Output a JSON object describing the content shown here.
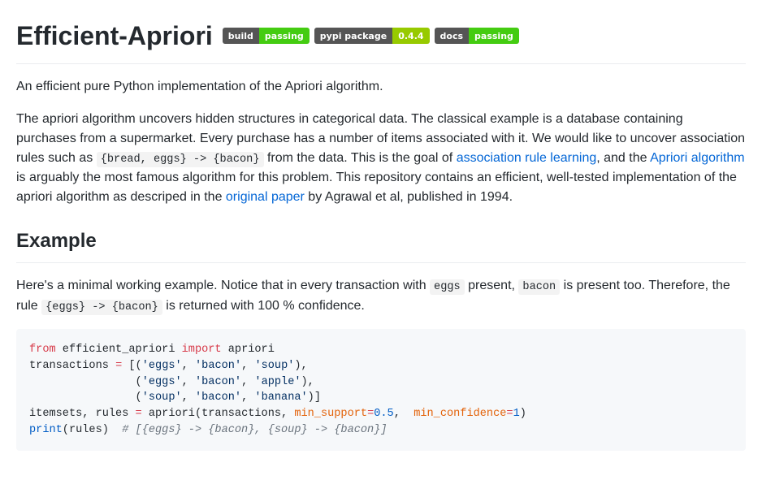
{
  "title": "Efficient-Apriori",
  "badges": [
    {
      "left": "build",
      "right": "passing",
      "color": "green"
    },
    {
      "left": "pypi package",
      "right": "0.4.4",
      "color": "olive"
    },
    {
      "left": "docs",
      "right": "passing",
      "color": "green"
    }
  ],
  "intro": "An efficient pure Python implementation of the Apriori algorithm.",
  "desc": {
    "p1a": "The apriori algorithm uncovers hidden structures in categorical data. The classical example is a database containing purchases from a supermarket. Every purchase has a number of items associated with it. We would like to uncover association rules such as ",
    "code1": "{bread, eggs} -> {bacon}",
    "p1b": " from the data. This is the goal of ",
    "link1": "association rule learning",
    "p1c": ", and the ",
    "link2": "Apriori algorithm",
    "p1d": " is arguably the most famous algorithm for this problem. This repository contains an efficient, well-tested implementation of the apriori algorithm as descriped in the ",
    "link3": "original paper",
    "p1e": " by Agrawal et al, published in 1994."
  },
  "exampleHeading": "Example",
  "exampleIntro": {
    "a": "Here's a minimal working example. Notice that in every transaction with ",
    "code1": "eggs",
    "b": " present, ",
    "code2": "bacon",
    "c": " is present too. Therefore, the rule ",
    "code3": "{eggs} -> {bacon}",
    "d": " is returned with 100 % confidence."
  },
  "code": {
    "l1_from": "from",
    "l1_mod": " efficient_apriori ",
    "l1_import": "import",
    "l1_name": " apriori",
    "l2_a": "transactions ",
    "l2_eq": "=",
    "l2_b": " [(",
    "l2_s1": "'eggs'",
    "l2_c1": ", ",
    "l2_s2": "'bacon'",
    "l2_c2": ", ",
    "l2_s3": "'soup'",
    "l2_end": "),",
    "l3_pad": "                (",
    "l3_s1": "'eggs'",
    "l3_c1": ", ",
    "l3_s2": "'bacon'",
    "l3_c2": ", ",
    "l3_s3": "'apple'",
    "l3_end": "),",
    "l4_pad": "                (",
    "l4_s1": "'soup'",
    "l4_c1": ", ",
    "l4_s2": "'bacon'",
    "l4_c2": ", ",
    "l4_s3": "'banana'",
    "l4_end": ")]",
    "l5_a": "itemsets, rules ",
    "l5_eq": "=",
    "l5_b": " apriori(transactions, ",
    "l5_arg1": "min_support",
    "l5_eq2": "=",
    "l5_num1": "0.5",
    "l5_c": ",  ",
    "l5_arg2": "min_confidence",
    "l5_eq3": "=",
    "l5_num2": "1",
    "l5_d": ")",
    "l6_print": "print",
    "l6_a": "(rules)  ",
    "l6_cm": "# [{eggs} -> {bacon}, {soup} -> {bacon}]"
  }
}
